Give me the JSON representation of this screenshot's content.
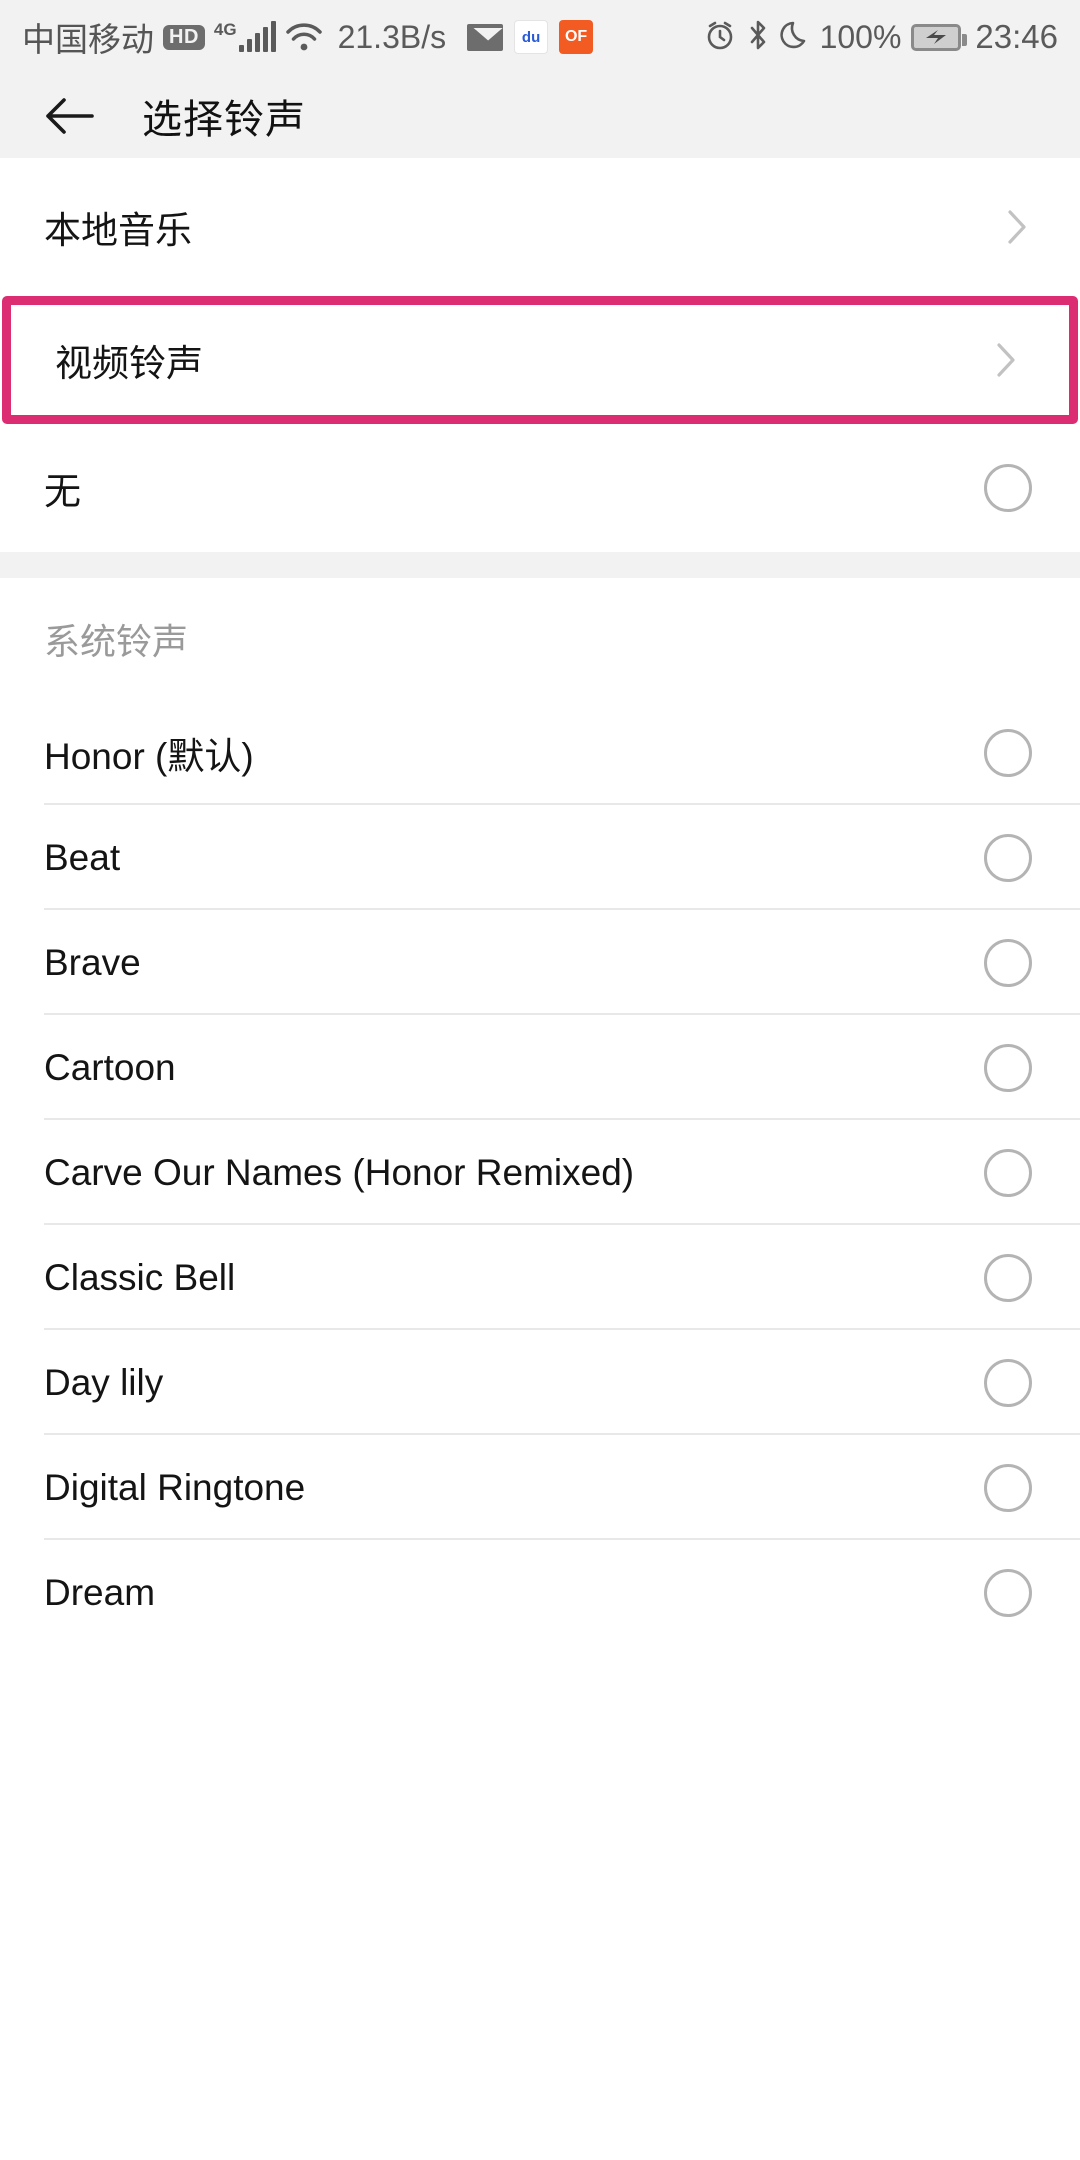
{
  "statusbar": {
    "carrier": "中国移动",
    "hd_badge": "HD",
    "network_type": "4G",
    "data_rate": "21.3B/s",
    "notification_icons": [
      {
        "name": "mail-icon",
        "glyph": "",
        "color": "#6d6d6d"
      },
      {
        "name": "baidu-icon",
        "glyph": "du",
        "color": "#ffffff",
        "text_color": "#2a5bd7"
      },
      {
        "name": "orange-app-icon",
        "glyph": "OF",
        "color": "#f25b22",
        "text_color": "#ffffff"
      }
    ],
    "alarm_icon": "alarm-icon",
    "bluetooth_icon": "bluetooth-icon",
    "dnd_icon": "moon-icon",
    "battery_percent": "100%",
    "battery_state": "charging",
    "time": "23:46"
  },
  "appbar": {
    "back_label": "back-arrow",
    "title": "选择铃声"
  },
  "nav_rows": [
    {
      "label": "本地音乐",
      "highlighted": false
    },
    {
      "label": "视频铃声",
      "highlighted": true
    }
  ],
  "none_row": {
    "label": "无",
    "selected": false
  },
  "section": {
    "title": "系统铃声"
  },
  "ringtones": [
    {
      "label": "Honor (默认)",
      "selected": false
    },
    {
      "label": "Beat",
      "selected": false
    },
    {
      "label": "Brave",
      "selected": false
    },
    {
      "label": "Cartoon",
      "selected": false
    },
    {
      "label": "Carve Our Names (Honor Remixed)",
      "selected": false
    },
    {
      "label": "Classic Bell",
      "selected": false
    },
    {
      "label": "Day lily",
      "selected": false
    },
    {
      "label": "Digital Ringtone",
      "selected": false
    },
    {
      "label": "Dream",
      "selected": false
    }
  ],
  "colors": {
    "highlight": "#dd2d72",
    "statusbar_bg": "#f2f2f2",
    "text_primary": "#141414",
    "text_muted": "#9a9a9a",
    "divider": "#e8e8e8"
  }
}
